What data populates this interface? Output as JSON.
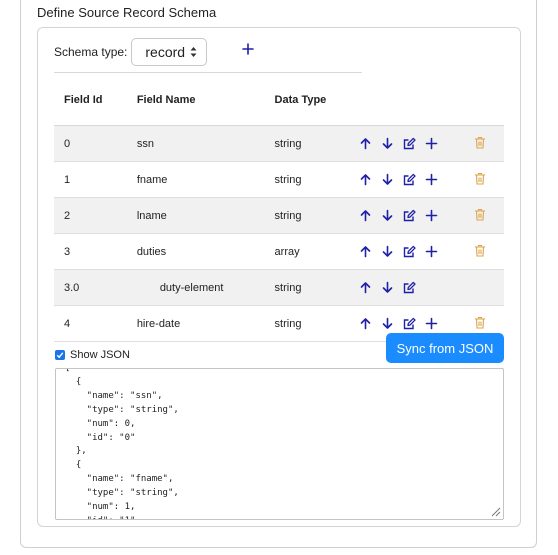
{
  "section_title": "Define Source Record Schema",
  "schema": {
    "label": "Schema type:",
    "selected": "record"
  },
  "columns": [
    "Field Id",
    "Field Name",
    "Data Type"
  ],
  "rows": [
    {
      "id": "0",
      "name": "ssn",
      "type": "string",
      "actions": [
        "arrow-up-icon",
        "arrow-down-icon",
        "edit-icon",
        "plus-icon"
      ],
      "deletable": true
    },
    {
      "id": "1",
      "name": "fname",
      "type": "string",
      "actions": [
        "arrow-up-icon",
        "arrow-down-icon",
        "edit-icon",
        "plus-icon"
      ],
      "deletable": true
    },
    {
      "id": "2",
      "name": "lname",
      "type": "string",
      "actions": [
        "arrow-up-icon",
        "arrow-down-icon",
        "edit-icon",
        "plus-icon"
      ],
      "deletable": true
    },
    {
      "id": "3",
      "name": "duties",
      "type": "array",
      "actions": [
        "arrow-up-icon",
        "arrow-down-icon",
        "edit-icon",
        "plus-icon"
      ],
      "deletable": true
    },
    {
      "id": "3.0",
      "name": "duty-element",
      "type": "string",
      "actions": [
        "arrow-up-icon",
        "arrow-down-icon",
        "edit-icon"
      ],
      "deletable": false,
      "nested": true
    },
    {
      "id": "4",
      "name": "hire-date",
      "type": "string",
      "actions": [
        "arrow-up-icon",
        "arrow-down-icon",
        "edit-icon",
        "plus-icon"
      ],
      "deletable": true
    }
  ],
  "show_json": {
    "label": "Show JSON",
    "checked": true
  },
  "sync_button": "Sync from JSON",
  "json_text": "[\n  {\n    \"name\": \"ssn\",\n    \"type\": \"string\",\n    \"num\": 0,\n    \"id\": \"0\"\n  },\n  {\n    \"name\": \"fname\",\n    \"type\": \"string\",\n    \"num\": 1,\n    \"id\": \"1\"",
  "colors": {
    "accent": "#1a8cff",
    "icon": "#1f1fa8",
    "delete": "#e0a34a",
    "row_alt": "#f1f1f1"
  }
}
